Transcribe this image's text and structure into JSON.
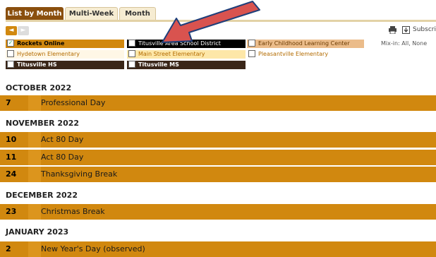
{
  "tabs": [
    {
      "label": "List by Month",
      "active": true
    },
    {
      "label": "Multi-Week",
      "active": false
    },
    {
      "label": "Month",
      "active": false
    }
  ],
  "nav": {
    "prev": "◄",
    "next": "►"
  },
  "toolbar": {
    "subscribe_label": "Subscrib"
  },
  "calendars": {
    "rockets": {
      "label": "Rockets Online",
      "checked": true
    },
    "titusville_district": {
      "label": "Titusville Area School District",
      "checked": false
    },
    "early_learning": {
      "label": "Early Childhood Learning Center",
      "checked": false
    },
    "hydetown": {
      "label": "Hydetown Elementary",
      "checked": false
    },
    "main_street": {
      "label": "Main Street Elementary",
      "checked": false
    },
    "pleasantville": {
      "label": "Pleasantville Elementary",
      "checked": false
    },
    "titusville_hs": {
      "label": "Titusville HS",
      "checked": false
    },
    "titusville_ms": {
      "label": "Titusville MS",
      "checked": false
    }
  },
  "mixin": "Mix-in: All, None",
  "months": [
    {
      "name": "OCTOBER 2022",
      "events": [
        {
          "day": "7",
          "title": "Professional Day"
        }
      ]
    },
    {
      "name": "NOVEMBER 2022",
      "events": [
        {
          "day": "10",
          "title": "Act 80 Day"
        },
        {
          "day": "11",
          "title": "Act 80 Day"
        },
        {
          "day": "24",
          "title": "Thanksgiving Break"
        }
      ]
    },
    {
      "name": "DECEMBER 2022",
      "events": [
        {
          "day": "23",
          "title": "Christmas Break"
        }
      ]
    },
    {
      "name": "JANUARY 2023",
      "events": [
        {
          "day": "2",
          "title": "New Year's Day (observed)"
        }
      ]
    }
  ],
  "colors": {
    "event_bar": "#d1880f",
    "active_tab": "#8a4f0e",
    "annotation_arrow": "#d9534f"
  }
}
